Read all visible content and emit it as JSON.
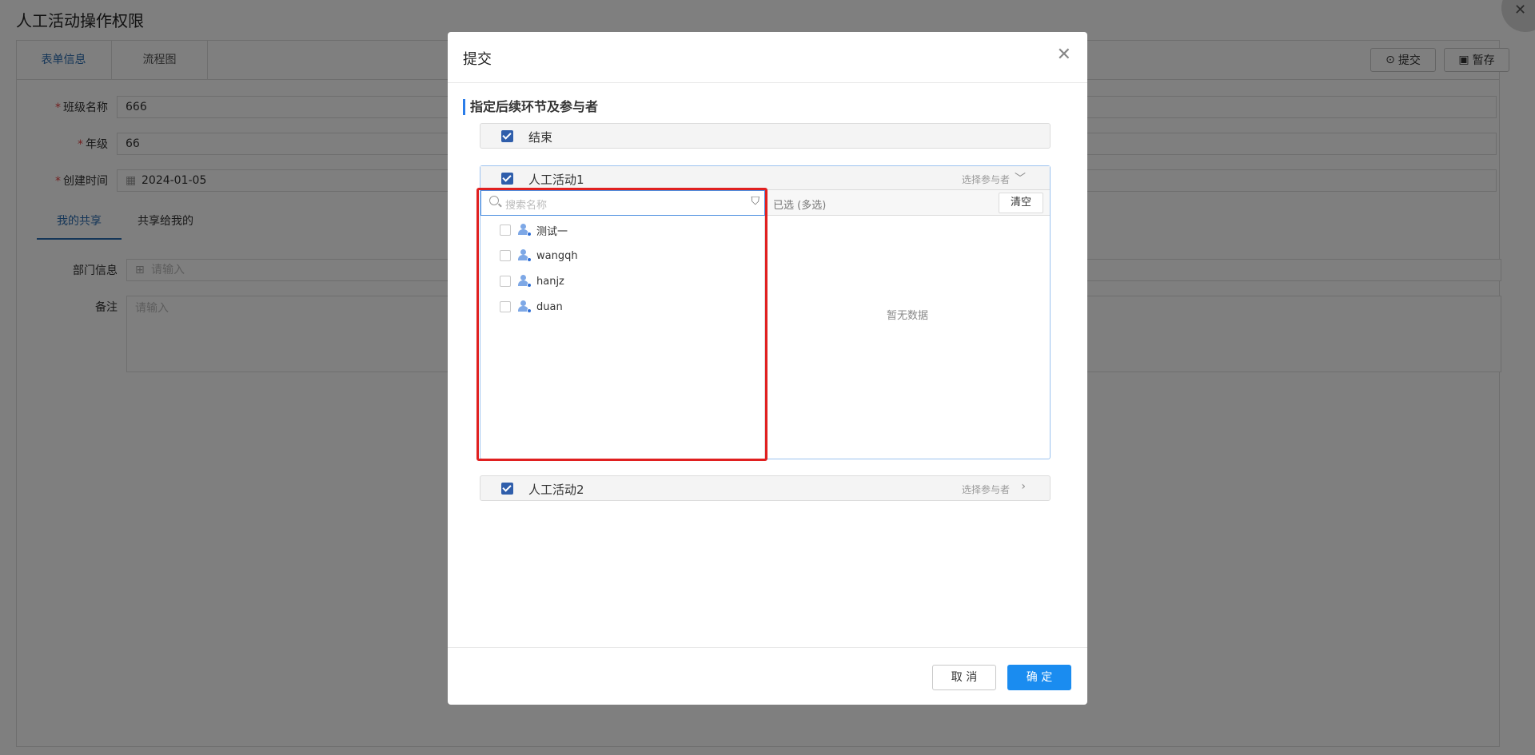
{
  "page": {
    "title": "人工活动操作权限",
    "tabs": [
      {
        "label": "表单信息"
      },
      {
        "label": "流程图"
      }
    ],
    "actions": {
      "submit_label": "提交",
      "save_label": "暂存"
    },
    "form": {
      "class_name": {
        "label": "班级名称",
        "value": "666"
      },
      "grade": {
        "label": "年级",
        "value": "66"
      },
      "created": {
        "label": "创建时间",
        "value": "2024-01-05"
      }
    },
    "subtabs": [
      {
        "label": "我的共享"
      },
      {
        "label": "共享给我的"
      }
    ],
    "department": {
      "label": "部门信息",
      "placeholder": "请输入"
    },
    "remark": {
      "label": "备注",
      "placeholder": "请输入"
    }
  },
  "modal": {
    "title": "提交",
    "section_title": "指定后续环节及参与者",
    "nodes": [
      {
        "label": "结束"
      },
      {
        "label": "人工活动1",
        "action": "选择参与者"
      },
      {
        "label": "人工活动2",
        "action": "选择参与者"
      }
    ],
    "search_placeholder": "搜索名称",
    "users": [
      {
        "name": "测试一"
      },
      {
        "name": "wangqh"
      },
      {
        "name": "hanjz"
      },
      {
        "name": "duan"
      }
    ],
    "selected": {
      "title": "已选 (多选)",
      "clear_label": "清空",
      "empty_text": "暂无数据"
    },
    "footer": {
      "cancel_label": "取 消",
      "ok_label": "确 定"
    }
  },
  "colors": {
    "primary": "#1a8cf0",
    "accent_checkbox": "#2f5eab",
    "highlight": "#e02020"
  }
}
